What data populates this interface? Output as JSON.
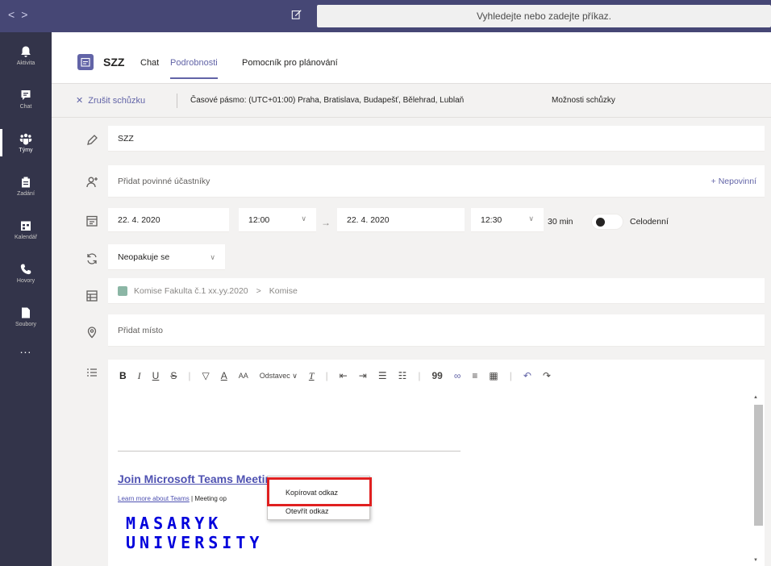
{
  "titlebar": {
    "back_label": "<",
    "forward_label": ">",
    "search_placeholder": "Vyhledejte nebo zadejte příkaz."
  },
  "rail": {
    "items": [
      {
        "label": "Aktivita",
        "icon": "bell-icon"
      },
      {
        "label": "Chat",
        "icon": "chat-icon"
      },
      {
        "label": "Týmy",
        "icon": "teams-icon"
      },
      {
        "label": "Zadání",
        "icon": "assignments-icon"
      },
      {
        "label": "Kalendář",
        "icon": "calendar-icon"
      },
      {
        "label": "Hovory",
        "icon": "phone-icon"
      },
      {
        "label": "Soubory",
        "icon": "files-icon"
      }
    ],
    "more_label": "..."
  },
  "header": {
    "title": "SZZ",
    "tabs": [
      {
        "label": "Chat"
      },
      {
        "label": "Podrobnosti"
      },
      {
        "label": "Pomocník pro plánování"
      }
    ]
  },
  "subbar": {
    "cancel_label": "Zrušit schůzku",
    "timezone_label": "Časové pásmo: (UTC+01:00) Praha, Bratislava, Budapešť, Bělehrad, Lublaň",
    "options_label": "Možnosti schůzky"
  },
  "form": {
    "title_value": "SZZ",
    "attendees_placeholder": "Přidat povinné účastníky",
    "optional_label": "+ Nepovinní",
    "start_date": "22. 4. 2020",
    "start_time": "12:00",
    "end_date": "22. 4. 2020",
    "end_time": "12:30",
    "duration": "30 min",
    "allday_label": "Celodenní",
    "recurrence": "Neopakuje se",
    "channel_team": "Komise Fakulta č.1 xx.yy.2020",
    "channel_separator": ">",
    "channel_name": "Komise",
    "location_placeholder": "Přidat místo"
  },
  "editor": {
    "toolbar": {
      "bold": "B",
      "italic": "I",
      "underline": "U",
      "strike": "S",
      "paragraph": "Odstavec",
      "paragraph_chevron": "∨",
      "clear_format": "T",
      "quote": "99"
    },
    "join_link": "Join Microsoft Teams Meeting",
    "learn_more": "Learn more about Teams",
    "meeting_options_partial": "| Meeting op",
    "logo_line1": "MASARYK",
    "logo_line2": "UNIVERSITY"
  },
  "context_menu": {
    "copy_link": "Kopírovat odkaz",
    "open_link": "Otevřít odkaz"
  },
  "colors": {
    "brand": "#6264a7",
    "titlebar": "#464775",
    "rail": "#33344a",
    "highlight": "#e02020",
    "logo": "#0000dc"
  }
}
